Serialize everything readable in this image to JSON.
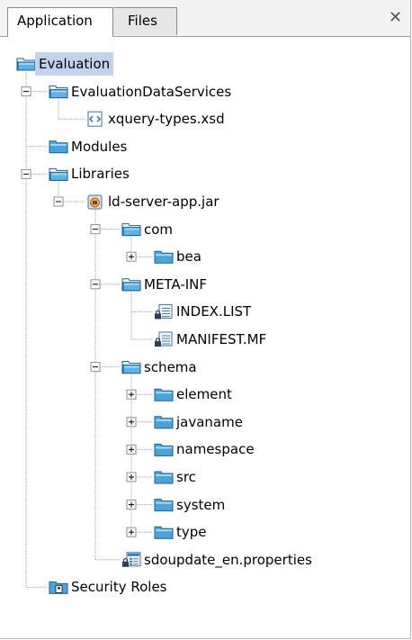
{
  "tabs": {
    "application": "Application",
    "files": "Files",
    "close": "✕"
  },
  "tree": [
    {
      "label": "Evaluation",
      "icon": "folder-open-icon",
      "depth": 0,
      "expander": "none",
      "selected": true
    },
    {
      "label": "EvaluationDataServices",
      "icon": "folder-open-icon",
      "depth": 1,
      "expander": "minus"
    },
    {
      "label": "xquery-types.xsd",
      "icon": "xsd-file-icon",
      "depth": 2,
      "expander": "none"
    },
    {
      "label": "Modules",
      "icon": "folder-closed-icon",
      "depth": 1,
      "expander": "none"
    },
    {
      "label": "Libraries",
      "icon": "folder-open-icon",
      "depth": 1,
      "expander": "minus"
    },
    {
      "label": "ld-server-app.jar",
      "icon": "jar-icon",
      "depth": 2,
      "expander": "minus"
    },
    {
      "label": "com",
      "icon": "folder-open-icon",
      "depth": 3,
      "expander": "minus"
    },
    {
      "label": "bea",
      "icon": "folder-closed-icon",
      "depth": 4,
      "expander": "plus"
    },
    {
      "label": "META-INF",
      "icon": "folder-open-icon",
      "depth": 3,
      "expander": "minus"
    },
    {
      "label": "INDEX.LIST",
      "icon": "locked-text-file-icon",
      "depth": 4,
      "expander": "none"
    },
    {
      "label": "MANIFEST.MF",
      "icon": "locked-text-file-icon",
      "depth": 4,
      "expander": "none"
    },
    {
      "label": "schema",
      "icon": "folder-open-icon",
      "depth": 3,
      "expander": "minus"
    },
    {
      "label": "element",
      "icon": "folder-closed-icon",
      "depth": 4,
      "expander": "plus"
    },
    {
      "label": "javaname",
      "icon": "folder-closed-icon",
      "depth": 4,
      "expander": "plus"
    },
    {
      "label": "namespace",
      "icon": "folder-closed-icon",
      "depth": 4,
      "expander": "plus"
    },
    {
      "label": "src",
      "icon": "folder-closed-icon",
      "depth": 4,
      "expander": "plus"
    },
    {
      "label": "system",
      "icon": "folder-closed-icon",
      "depth": 4,
      "expander": "plus"
    },
    {
      "label": "type",
      "icon": "folder-closed-icon",
      "depth": 4,
      "expander": "plus"
    },
    {
      "label": "sdoupdate_en.properties",
      "icon": "properties-file-icon",
      "depth": 3,
      "expander": "none"
    },
    {
      "label": "Security Roles",
      "icon": "security-roles-folder-icon",
      "depth": 1,
      "expander": "none"
    }
  ],
  "colors": {
    "highlight": "#c2d3ec",
    "folder": "#4aa3d9",
    "line": "#a0a0a0"
  }
}
